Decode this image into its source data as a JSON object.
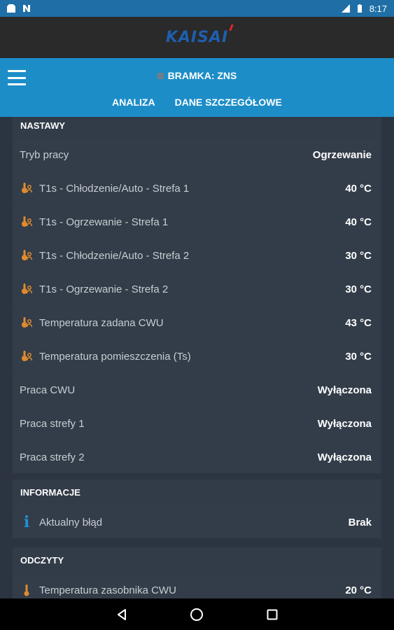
{
  "statusbar": {
    "time": "8:17"
  },
  "brand": {
    "logo_text": "KAISAI"
  },
  "appbar": {
    "gateway_label": "BRAMKA: ZNS",
    "tabs": [
      {
        "label": "ANALIZA"
      },
      {
        "label": "DANE SZCZEGÓŁOWE"
      }
    ]
  },
  "sections": {
    "nastawy": {
      "title": "NASTAWY",
      "rows": [
        {
          "label": "Tryb pracy",
          "value": "Ogrzewanie",
          "icon": "none"
        },
        {
          "label": "T1s - Chłodzenie/Auto - Strefa 1",
          "value": "40 °C",
          "icon": "thermometer-person-icon"
        },
        {
          "label": "T1s - Ogrzewanie - Strefa 1",
          "value": "40 °C",
          "icon": "thermometer-person-icon"
        },
        {
          "label": "T1s - Chłodzenie/Auto - Strefa 2",
          "value": "30 °C",
          "icon": "thermometer-person-icon"
        },
        {
          "label": "T1s - Ogrzewanie - Strefa 2",
          "value": "30 °C",
          "icon": "thermometer-person-icon"
        },
        {
          "label": "Temperatura zadana CWU",
          "value": "43 °C",
          "icon": "thermometer-person-icon"
        },
        {
          "label": "Temperatura pomieszczenia (Ts)",
          "value": "30 °C",
          "icon": "thermometer-person-icon"
        },
        {
          "label": "Praca CWU",
          "value": "Wyłączona",
          "icon": "none"
        },
        {
          "label": "Praca strefy 1",
          "value": "Wyłączona",
          "icon": "none"
        },
        {
          "label": "Praca strefy 2",
          "value": "Wyłączona",
          "icon": "none"
        }
      ]
    },
    "informacje": {
      "title": "INFORMACJE",
      "rows": [
        {
          "label": "Aktualny błąd",
          "value": "Brak",
          "icon": "info-icon"
        }
      ]
    },
    "odczyty": {
      "title": "ODCZYTY",
      "rows": [
        {
          "label": "Temperatura zasobnika CWU",
          "value": "20 °C",
          "icon": "thermometer-icon"
        }
      ]
    }
  },
  "colors": {
    "accent": "#1d8dc8",
    "icon_orange": "#e08a2c",
    "background": "#2b3440",
    "row": "#333d49"
  }
}
